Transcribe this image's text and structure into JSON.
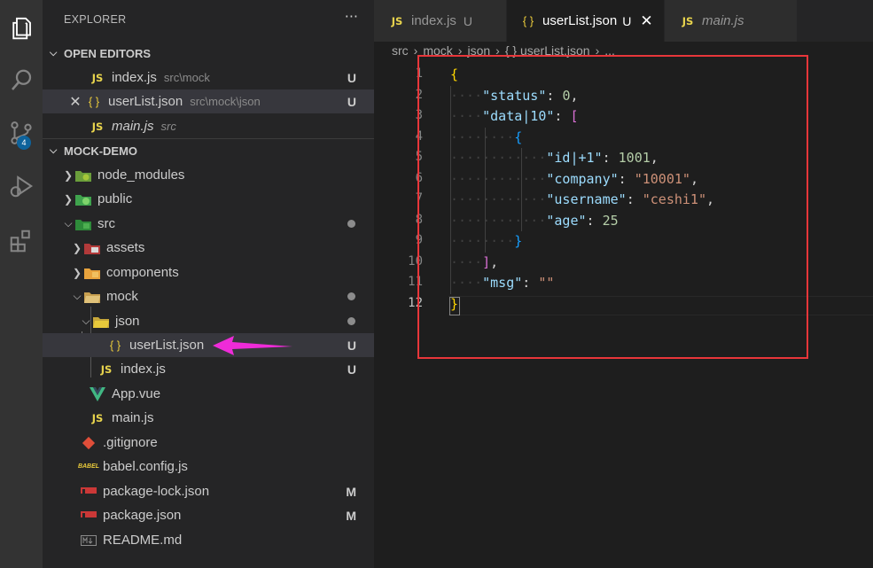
{
  "explorer": {
    "title": "EXPLORER",
    "more": "···",
    "open_editors_header": "OPEN EDITORS",
    "open_editors": [
      {
        "icon": "JS",
        "name": "index.js",
        "path": "src\\mock",
        "status": "U"
      },
      {
        "icon": "{ }",
        "name": "userList.json",
        "path": "src\\mock\\json",
        "status": "U",
        "close": "✕"
      },
      {
        "icon": "JS",
        "name": "main.js",
        "path": "src",
        "status": ""
      }
    ],
    "project_header": "MOCK-DEMO",
    "tree": [
      {
        "name": "node_modules",
        "status": ""
      },
      {
        "name": "public",
        "status": ""
      },
      {
        "name": "src",
        "status": "dot"
      },
      {
        "name": "assets",
        "status": ""
      },
      {
        "name": "components",
        "status": ""
      },
      {
        "name": "mock",
        "status": "dot"
      },
      {
        "name": "json",
        "status": "dot"
      },
      {
        "name": "userList.json",
        "status": "U"
      },
      {
        "name": "index.js",
        "status": "U"
      },
      {
        "name": "App.vue",
        "status": ""
      },
      {
        "name": "main.js",
        "status": ""
      },
      {
        "name": ".gitignore",
        "status": ""
      },
      {
        "name": "babel.config.js",
        "status": ""
      },
      {
        "name": "package-lock.json",
        "status": "M"
      },
      {
        "name": "package.json",
        "status": "M"
      },
      {
        "name": "README.md",
        "status": ""
      }
    ]
  },
  "activity": {
    "scm_badge": "4"
  },
  "tabs": [
    {
      "icon": "JS",
      "label": "index.js",
      "mark": "U"
    },
    {
      "icon": "{ }",
      "label": "userList.json",
      "mark": "U",
      "close": "✕"
    },
    {
      "icon": "JS",
      "label": "main.js",
      "mark": ""
    }
  ],
  "breadcrumb": [
    "src",
    "mock",
    "json",
    "{ } userList.json",
    "..."
  ],
  "editor": {
    "line_numbers": [
      "1",
      "2",
      "3",
      "4",
      "5",
      "6",
      "7",
      "8",
      "9",
      "10",
      "11",
      "12"
    ],
    "lines": [
      {
        "tokens": [
          [
            "b1",
            "{"
          ]
        ]
      },
      {
        "tokens": [
          [
            "ws",
            "····"
          ],
          [
            "k",
            "\"status\""
          ],
          [
            "p",
            ": "
          ],
          [
            "n",
            "0"
          ],
          [
            "p",
            ","
          ]
        ]
      },
      {
        "tokens": [
          [
            "ws",
            "····"
          ],
          [
            "k",
            "\"data|10\""
          ],
          [
            "p",
            ": "
          ],
          [
            "b2",
            "["
          ]
        ]
      },
      {
        "tokens": [
          [
            "ws",
            "········"
          ],
          [
            "b3",
            "{"
          ]
        ]
      },
      {
        "tokens": [
          [
            "ws",
            "············"
          ],
          [
            "k",
            "\"id|+1\""
          ],
          [
            "p",
            ": "
          ],
          [
            "n",
            "1001"
          ],
          [
            "p",
            ","
          ]
        ]
      },
      {
        "tokens": [
          [
            "ws",
            "············"
          ],
          [
            "k",
            "\"company\""
          ],
          [
            "p",
            ": "
          ],
          [
            "s",
            "\"10001\""
          ],
          [
            "p",
            ","
          ]
        ]
      },
      {
        "tokens": [
          [
            "ws",
            "············"
          ],
          [
            "k",
            "\"username\""
          ],
          [
            "p",
            ": "
          ],
          [
            "s",
            "\"ceshi1\""
          ],
          [
            "p",
            ","
          ]
        ]
      },
      {
        "tokens": [
          [
            "ws",
            "············"
          ],
          [
            "k",
            "\"age\""
          ],
          [
            "p",
            ": "
          ],
          [
            "n",
            "25"
          ]
        ]
      },
      {
        "tokens": [
          [
            "ws",
            "········"
          ],
          [
            "b3",
            "}"
          ]
        ]
      },
      {
        "tokens": [
          [
            "ws",
            "····"
          ],
          [
            "b2",
            "]"
          ],
          [
            "p",
            ","
          ]
        ]
      },
      {
        "tokens": [
          [
            "ws",
            "····"
          ],
          [
            "k",
            "\"msg\""
          ],
          [
            "p",
            ": "
          ],
          [
            "s",
            "\"\""
          ]
        ]
      },
      {
        "tokens": [
          [
            "b1",
            "}"
          ]
        ]
      }
    ]
  },
  "colors": {
    "highlight_box": "#e8363a",
    "pointer_arrow": "#ee2bd8"
  }
}
